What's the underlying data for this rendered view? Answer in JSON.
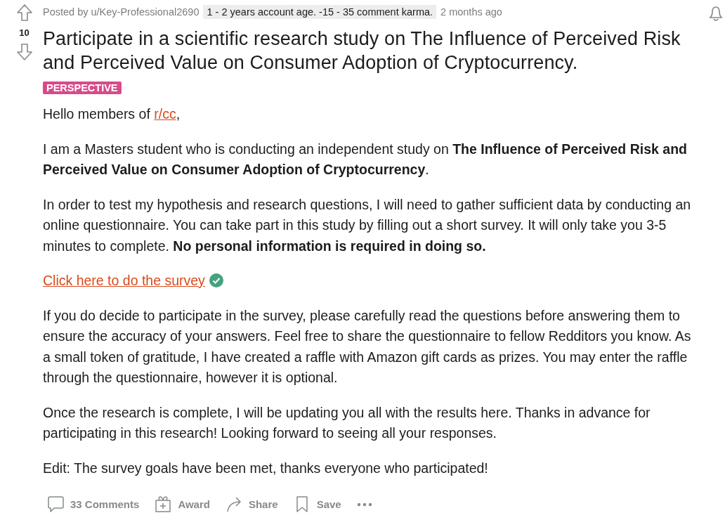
{
  "post": {
    "votes": "10",
    "author": "Posted by u/Key-Professional2690",
    "badge": "1 - 2 years account age. -15 - 35 comment karma.",
    "time": "2 months ago",
    "title": "Participate in a scientific research study on The Influence of Perceived Risk and Perceived Value on Consumer Adoption of Cryptocurrency.",
    "flair": "PERSPECTIVE",
    "paragraphs": [
      {
        "spans": [
          {
            "kind": "plain",
            "text": "Hello members of "
          },
          {
            "kind": "link",
            "text": "r/cc"
          },
          {
            "kind": "plain",
            "text": ","
          }
        ]
      },
      {
        "spans": [
          {
            "kind": "plain",
            "text": "I am a Masters student who is conducting an independent study on **The Influence of Perceived Risk and Perceived Value on Consumer Adoption of Cryptocurrency**."
          }
        ]
      },
      {
        "spans": [
          {
            "kind": "plain",
            "text": "In order to test my hypothesis and research questions, I will need to gather sufficient data by conducting an online questionnaire. You can take part in this study by filling out a short survey. It will only take you 3-5 minutes to complete. **No personal information is required in doing so.**"
          }
        ]
      },
      {
        "spans": [
          {
            "kind": "link",
            "text": "Click here to do the survey"
          },
          {
            "kind": "check"
          }
        ]
      },
      {
        "spans": [
          {
            "kind": "plain",
            "text": "If you do decide to participate in the survey, please carefully read the questions before answering them to ensure the accuracy of your answers. Feel free to share the questionnaire to fellow Redditors you know. As a small token of gratitude, I have created a raffle with Amazon gift cards as prizes. You may enter the raffle through the questionnaire, however it is optional."
          }
        ]
      },
      {
        "spans": [
          {
            "kind": "plain",
            "text": "Once the research is complete, I will be updating you all with the results here. Thanks in advance for participating in this research! Looking forward to seeing all your responses."
          }
        ]
      },
      {
        "spans": [
          {
            "kind": "plain",
            "text": "Edit: The survey goals have been met, thanks everyone who participated!"
          }
        ]
      }
    ],
    "actions": [
      {
        "kind": "comments",
        "label": "33 Comments"
      },
      {
        "kind": "award",
        "label": "Award"
      },
      {
        "kind": "share",
        "label": "Share"
      },
      {
        "kind": "save",
        "label": "Save"
      },
      {
        "kind": "more"
      }
    ]
  }
}
